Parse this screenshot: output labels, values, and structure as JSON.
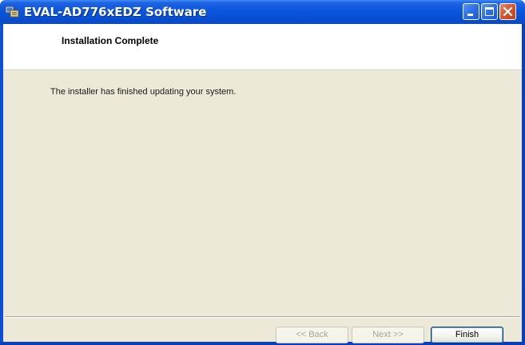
{
  "window": {
    "title": "EVAL-AD776xEDZ Software",
    "app_icon": "installer-app-icon",
    "controls": {
      "minimize_icon": "minimize-icon",
      "maximize_icon": "maximize-icon",
      "close_icon": "close-icon"
    }
  },
  "header": {
    "title": "Installation Complete"
  },
  "body": {
    "message": "The installer has finished updating your system."
  },
  "footer": {
    "back_label": "<< Back",
    "next_label": "Next >>",
    "finish_label": "Finish"
  },
  "colors": {
    "titlebar_blue": "#0a56dc",
    "dialog_background": "#ece9d8",
    "close_button_red": "#d8532c"
  }
}
